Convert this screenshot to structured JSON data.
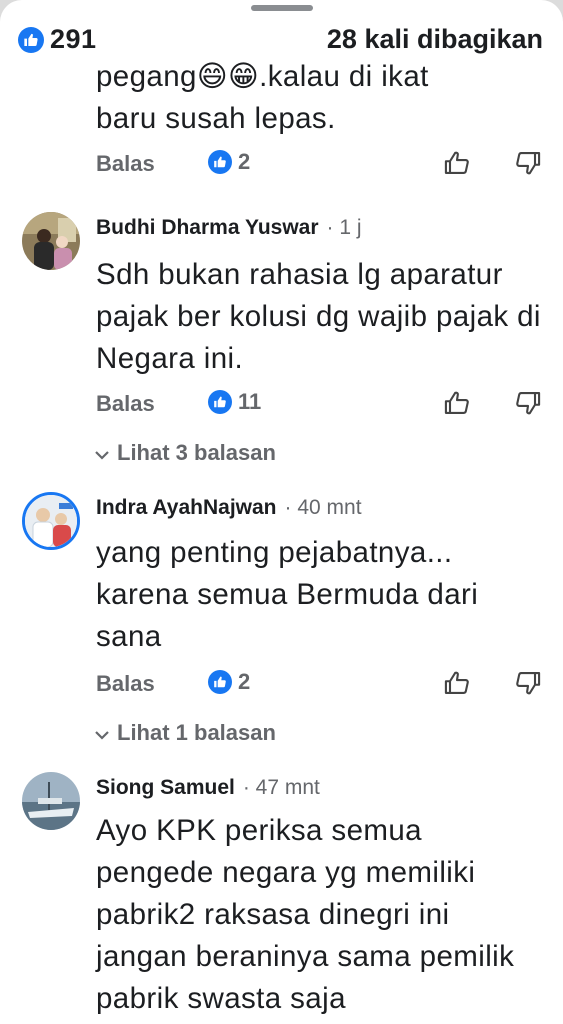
{
  "post_stats": {
    "like_count": "291",
    "share_text": "28 kali dibagikan"
  },
  "partial_comment": {
    "lines": [
      "pegang😄😁.kalau di ikat",
      "baru susah lepas."
    ],
    "reply_label": "Balas",
    "reaction_count": "2"
  },
  "comments": [
    {
      "name": "Budhi Dharma Yuswar",
      "time": "· 1 j",
      "text": "Sdh bukan rahasia lg aparatur pajak ber kolusi dg wajib pajak di Negara ini.",
      "reply_label": "Balas",
      "reaction_count": "11",
      "view_replies": "Lihat 3 balasan"
    },
    {
      "name": "Indra AyahNajwan",
      "time": "· 40 mnt",
      "text": "yang penting pejabatnya... karena semua Bermuda dari sana",
      "reply_label": "Balas",
      "reaction_count": "2",
      "view_replies": "Lihat 1 balasan"
    },
    {
      "name": "Siong Samuel",
      "time": "· 47 mnt",
      "text": "Ayo KPK periksa semua pengede negara yg memiliki pabrik2 raksasa dinegri ini jangan beraninya sama pemilik pabrik swasta saja"
    }
  ],
  "icons": {
    "like_badge": "thumbs-up-badge-icon",
    "like_button": "thumbs-up-outline-icon",
    "dislike_button": "thumbs-down-outline-icon",
    "expand": "chevron-down-icon"
  },
  "colors": {
    "accent": "#1877f2",
    "secondary_text": "#65676b",
    "primary_text": "#1c1e21"
  }
}
